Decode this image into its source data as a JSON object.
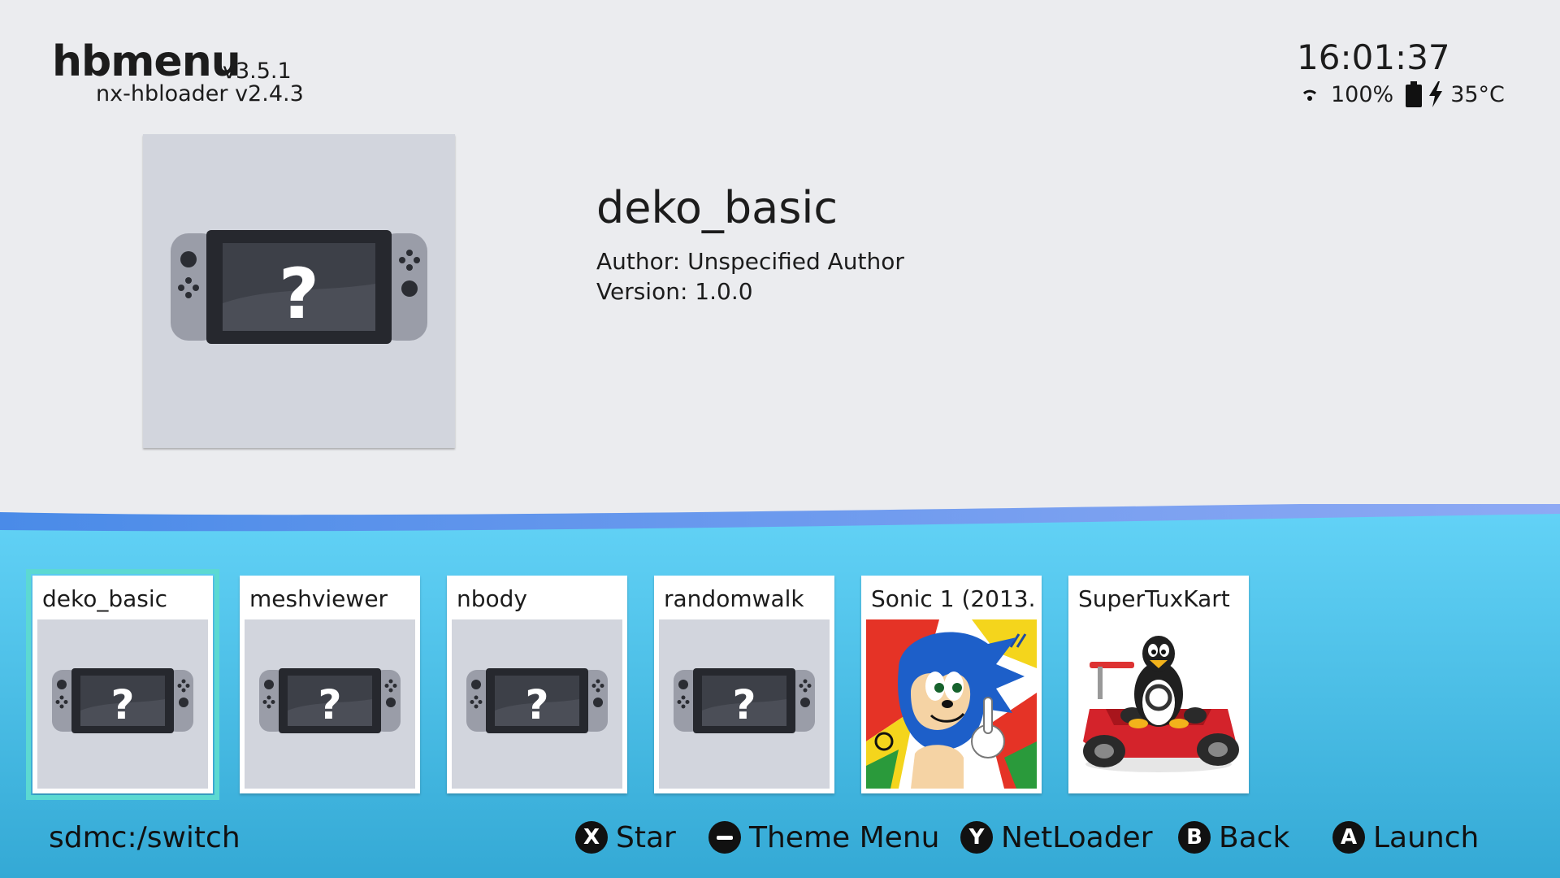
{
  "header": {
    "app_name": "hbmenu",
    "app_version": "v3.5.1",
    "loader_version": "nx-hbloader v2.4.3"
  },
  "status": {
    "time": "16:01:37",
    "battery": "100%",
    "temperature": "35°C",
    "icons": [
      "wifi-icon",
      "battery-icon",
      "charging-icon"
    ]
  },
  "selected": {
    "title": "deko_basic",
    "author": "Author: Unspecified Author",
    "version": "Version: 1.0.0"
  },
  "apps": [
    {
      "label": "deko_basic",
      "icon": "default-console-icon",
      "selected": true
    },
    {
      "label": "meshviewer",
      "icon": "default-console-icon"
    },
    {
      "label": "nbody",
      "icon": "default-console-icon"
    },
    {
      "label": "randomwalk",
      "icon": "default-console-icon"
    },
    {
      "label": "Sonic 1 (2013...",
      "icon": "sonic-artwork"
    },
    {
      "label": "SuperTuxKart",
      "icon": "tux-kart-artwork"
    }
  ],
  "footer": {
    "path": "sdmc:/switch",
    "hints": [
      {
        "button": "X",
        "label": "Star"
      },
      {
        "button": "-",
        "label": "Theme Menu"
      },
      {
        "button": "Y",
        "label": "NetLoader"
      },
      {
        "button": "B",
        "label": "Back"
      },
      {
        "button": "A",
        "label": "Launch"
      }
    ]
  },
  "colors": {
    "background": "#ebecef",
    "wave_top": "#5fd0f5",
    "wave_bottom": "#3aaed8",
    "selection": "#5cd9d2",
    "tile_art_bg": "#d2d5dd"
  }
}
